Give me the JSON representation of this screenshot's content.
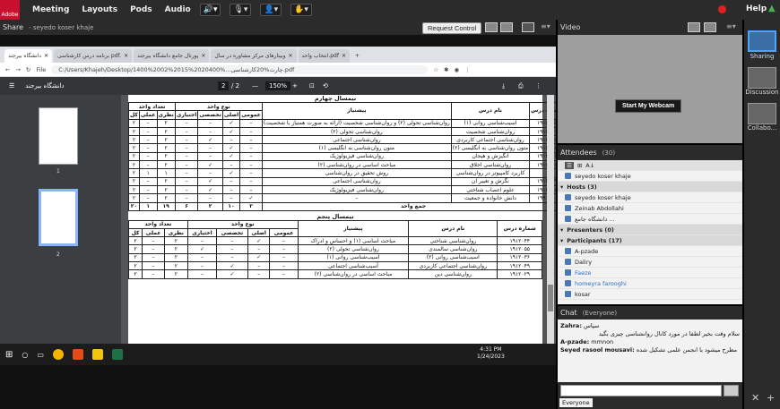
{
  "topbar": {
    "logo": "Adobe",
    "menus": [
      "Meeting",
      "Layouts",
      "Pods",
      "Audio"
    ],
    "help": "Help"
  },
  "share": {
    "title": "Share",
    "presenter": "- seyedo koser khaje",
    "request_control": "Request Control"
  },
  "browser": {
    "tabs": [
      "دانشگاه بیرجند",
      "برنامه درس کارشناسی pdf.",
      "پورتال جامع دانشگاه بیرجند",
      "وبینارهای مرکز مشاوره در سال",
      "انتخاب واحد.pdf",
      "+"
    ],
    "file_label": "File",
    "url": "C:/Users/Khajeh/Desktop/1400%2002%2015%2020400%...چارت%20کارشناسی.pdf",
    "pdf_title": "دانشگاه بیرجند",
    "page_current": "2",
    "page_total": "/ 2",
    "zoom": "150%"
  },
  "thumbnails": [
    "1",
    "2"
  ],
  "semester4": {
    "title": "نیمسال چهارم",
    "headers": {
      "code": "شماره درس",
      "name": "نام درس",
      "prereq": "پیشنیاز",
      "type": "نوع واحد",
      "general": "عمومی",
      "core": "اصلی",
      "special": "تخصصی",
      "elective": "اختیاری",
      "units": "تعداد واحد",
      "theory": "نظری",
      "practical": "عملی",
      "total": "کل"
    },
    "rows": [
      [
        "۱۹۱۲۰۳۵",
        "آسیب‌شناسی روانی (۱)",
        "روان‌شناسی تحولی (۲) و روان‌شناسی شخصیت (ارائه به صورت همنیاز با شخصیت)",
        "–",
        "✓",
        "–",
        "–",
        "۲",
        "–",
        "۲"
      ],
      [
        "۱۹۱۲۰۳۱",
        "روان‌شناسی شخصیت",
        "روان‌شناسی تحولی (۲)",
        "–",
        "✓",
        "–",
        "–",
        "۲",
        "–",
        "۲"
      ],
      [
        "۱۹۱۲۰۴۷",
        "روان‌شناسی اجتماعی کاربردی",
        "روان‌شناسی اجتماعی",
        "–",
        "–",
        "✓",
        "–",
        "۲",
        "–",
        "۲"
      ],
      [
        "۱۹۱۲۰۲۸",
        "متون روان‌شناسی به انگلیسی (۲)",
        "متون روان‌شناسی به انگلیسی (۱)",
        "–",
        "✓",
        "–",
        "–",
        "۲",
        "–",
        "۲"
      ],
      [
        "۱۹۱۲۰۱۶",
        "انگیزش و هیجان",
        "روان‌شناسی فیزیولوژیک",
        "–",
        "✓",
        "–",
        "–",
        "۲",
        "–",
        "۲"
      ],
      [
        "۱۹۱۲۰۶۷",
        "روان‌شناسی اخلاق",
        "مباحث اساسی در روان‌شناسی (۲)",
        "–",
        "–",
        "✓",
        "–",
        "۲",
        "–",
        "۲"
      ],
      [
        "",
        "کاربرد کامپیوتر در روان‌شناسی",
        "روش تحقیق در روان‌شناسی",
        "–",
        "✓",
        "–",
        "–",
        "۱",
        "۱",
        "۲"
      ],
      [
        "۱۹۱۲۰۶۹",
        "نگرش و تغییر آن",
        "روان‌شناسی اجتماعی",
        "–",
        "–",
        "✓",
        "–",
        "۲",
        "–",
        "۲"
      ],
      [
        "۱۹۱۲۰۵۸",
        "علوم اعصاب شناختی",
        "روان‌شناسی فیزیولوژیک",
        "–",
        "–",
        "✓",
        "–",
        "۲",
        "–",
        "۲"
      ],
      [
        "۱۹۹۰۰۲۰",
        "دانش خانواده و جمعیت",
        "–",
        "✓",
        "–",
        "–",
        "–",
        "۲",
        "–",
        "۲"
      ]
    ],
    "sum_label": "جمع واحد",
    "sum": [
      "۲",
      "۱۰",
      "۲",
      "۶",
      "۱۹",
      "۱",
      "۲۰"
    ]
  },
  "semester5": {
    "title": "نیمسال پنجم",
    "rows": [
      [
        "۱۹۱۲۰۴۴",
        "روان‌شناسی شناختی",
        "مباحث اساسی (۱) و احساس و ادراک",
        "–",
        "✓",
        "–",
        "–",
        "۲",
        "–",
        "۲"
      ],
      [
        "۱۹۱۲۰۵۵",
        "روان‌شناسی سالمندی",
        "روان‌شناسی تحولی (۲)",
        "–",
        "–",
        "–",
        "✓",
        "۲",
        "–",
        "۲"
      ],
      [
        "۱۹۱۲۰۳۶",
        "آسیب‌شناسی روانی (۲)",
        "آسیب‌شناسی روانی (۱)",
        "–",
        "✓",
        "–",
        "–",
        "۲",
        "–",
        "۲"
      ],
      [
        "۱۹۱۲۰۴۹",
        "روان‌شناسی اجتماعی کاربردی",
        "آسیب‌شناسی اجتماعی",
        "–",
        "–",
        "✓",
        "–",
        "۲",
        "–",
        "۲"
      ],
      [
        "۱۹۱۲۰۲۹",
        "روان‌شناسی دین",
        "مباحث اساسی در روان‌شناسی (۲)",
        "–",
        "–",
        "✓",
        "–",
        "۲",
        "–",
        "۲"
      ]
    ]
  },
  "clock": {
    "time": "4:31 PM",
    "date": "1/24/2023"
  },
  "video": {
    "title": "Video",
    "webcam_button": "Start My Webcam"
  },
  "layouts": [
    "Sharing",
    "Discussion",
    "Collabo..."
  ],
  "attendees": {
    "title": "Attendees",
    "count": "(30)",
    "me": "seyedo koser khaje",
    "hosts_label": "Hosts (3)",
    "hosts": [
      "seyedo koser khaje",
      "Zeinab Abdollahi",
      "دانشگاه جامع ..."
    ],
    "presenters_label": "Presenters (0)",
    "participants_label": "Participants (17)",
    "participants": [
      "A-pzade",
      "Daliry",
      "Faeze",
      "homeyra farooghi",
      "kosar"
    ]
  },
  "chat": {
    "title": "Chat",
    "scope": "(Everyone)",
    "messages": [
      {
        "name": "Zahra:",
        "text": "سپاس"
      },
      {
        "name": "",
        "text": "سلام وقت بخیر لطفا در مورد کانال روانشناسی چیزی بگید"
      },
      {
        "name": "A-pzade:",
        "text": "mmnon"
      },
      {
        "name": "Seyed rasool mousavi:",
        "text": "مطرح میشود با انجمن علمی تشکیل شده"
      }
    ],
    "tab": "Everyone"
  }
}
